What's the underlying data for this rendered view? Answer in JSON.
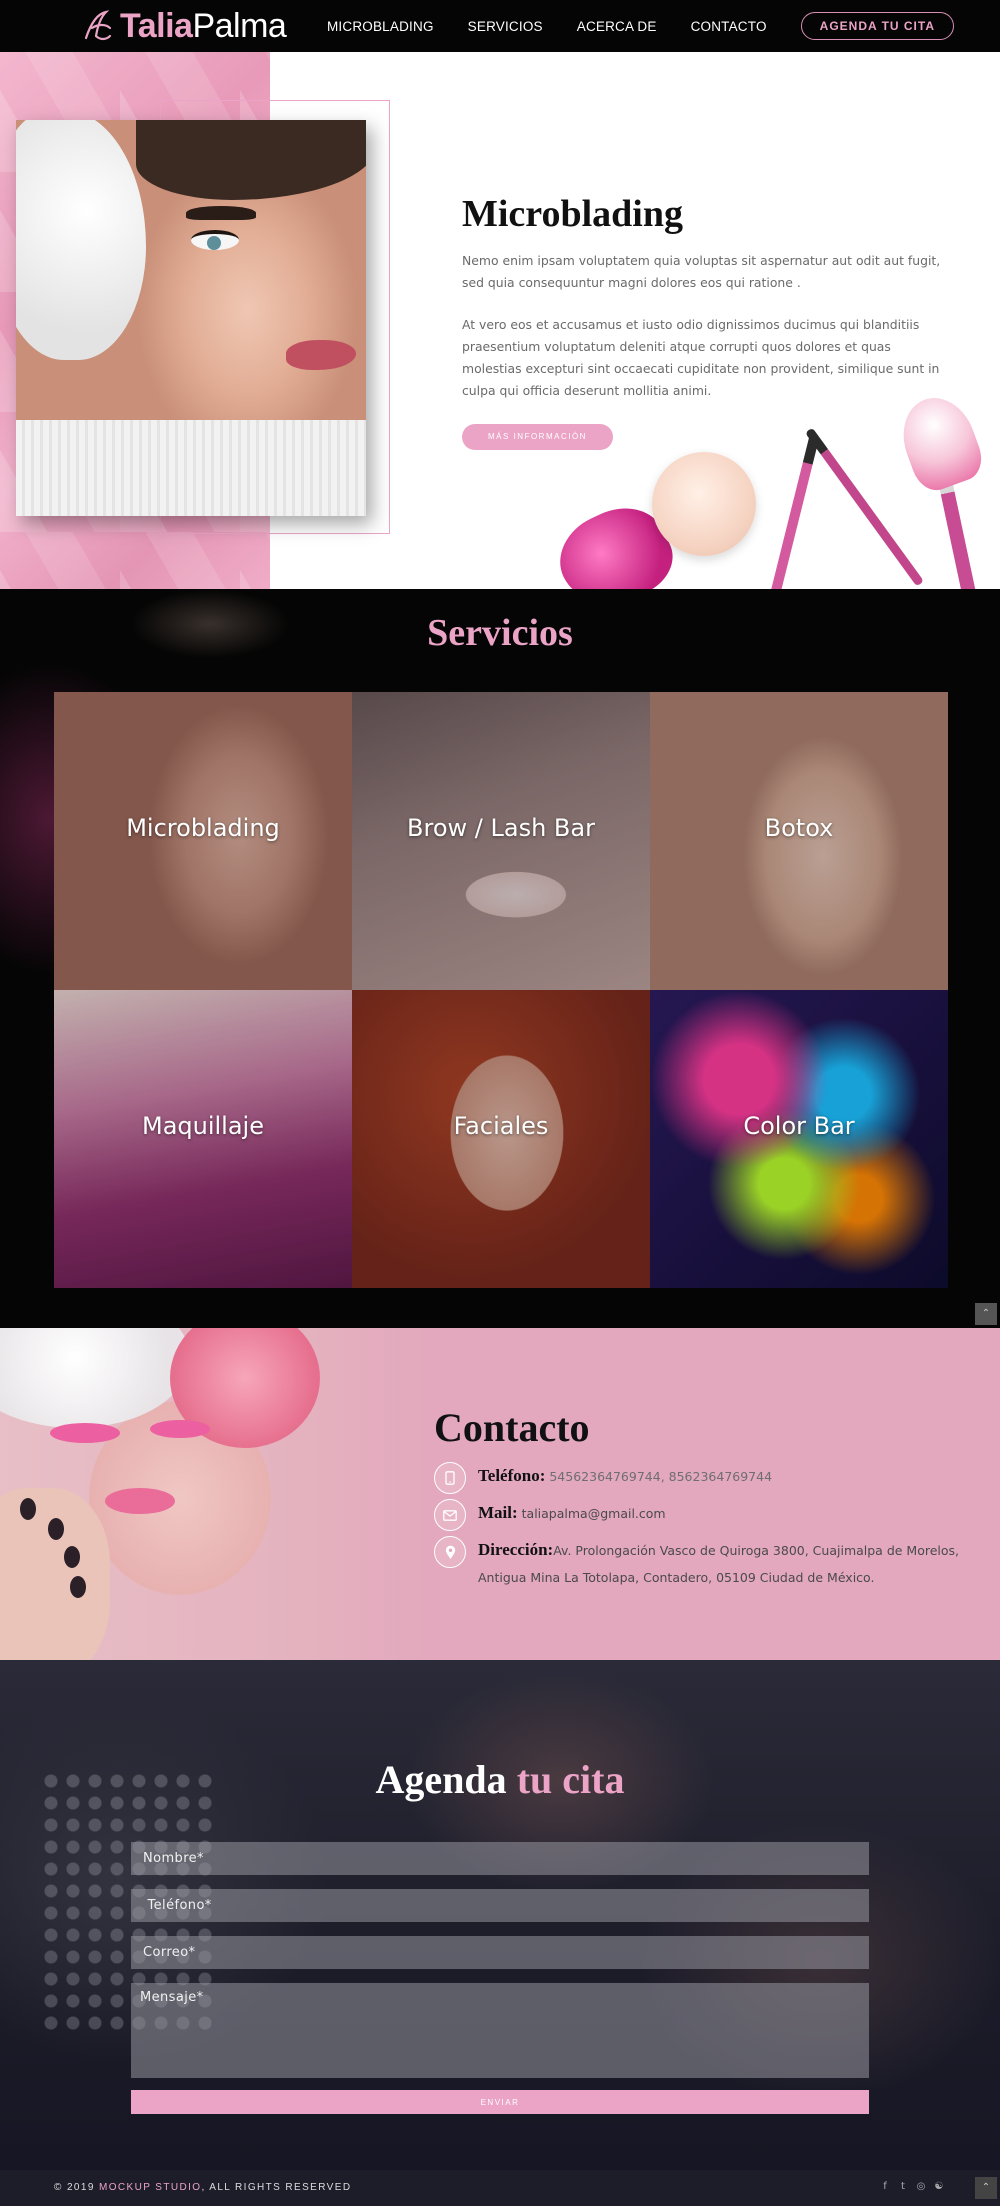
{
  "brand": {
    "name_bold": "Talia",
    "name_rest": "Palma",
    "accent": "#eba4c6"
  },
  "nav": {
    "links": [
      "MICROBLADING",
      "SERVICIOS",
      "ACERCA DE",
      "CONTACTO"
    ],
    "cta": "AGENDA TU CITA"
  },
  "hero": {
    "title": "Microblading",
    "p1": "Nemo enim ipsam voluptatem quia voluptas sit aspernatur aut odit aut fugit, sed quia consequuntur magni dolores eos qui ratione .",
    "p2": "At vero eos et accusamus et iusto odio dignissimos ducimus qui blanditiis praesentium voluptatum deleniti atque corrupti quos dolores et quas molestias excepturi sint occaecati cupiditate non provident, similique sunt in culpa qui officia deserunt mollitia animi.",
    "button": "MÁS INFORMACIÓN"
  },
  "services": {
    "title": "Servicios",
    "items": [
      "Microblading",
      "Brow / Lash Bar",
      "Botox",
      "Maquillaje",
      "Faciales",
      "Color Bar"
    ]
  },
  "contact": {
    "title": "Contacto",
    "phone_label": "Teléfono:",
    "phone_value": "54562364769744, 8562364769744",
    "mail_label": "Mail:",
    "mail_value": "taliapalma@gmail.com",
    "address_label": "Dirección:",
    "address_value": "Av. Prolongación Vasco de Quiroga 3800, Cuajimalpa de Morelos, Antigua Mina La Totolapa, Contadero, 05109 Ciudad de México.",
    "icons": [
      "mobile-phone-icon",
      "envelope-icon",
      "map-pin-icon"
    ]
  },
  "booking": {
    "title_white": "Agenda",
    "title_pink": "tu cita",
    "name_placeholder": "Nombre*",
    "phone_placeholder": " Teléfono*",
    "email_placeholder": "Correo*",
    "message_placeholder": "Mensaje*",
    "submit": "ENVIAR"
  },
  "footer": {
    "copy_prefix": "© 2019 ",
    "copy_studio": "MOCKUP STUDIO",
    "copy_suffix": ", ALL RIGHTS RESERVED",
    "social": [
      "f",
      "t",
      "◎",
      "☯"
    ]
  }
}
